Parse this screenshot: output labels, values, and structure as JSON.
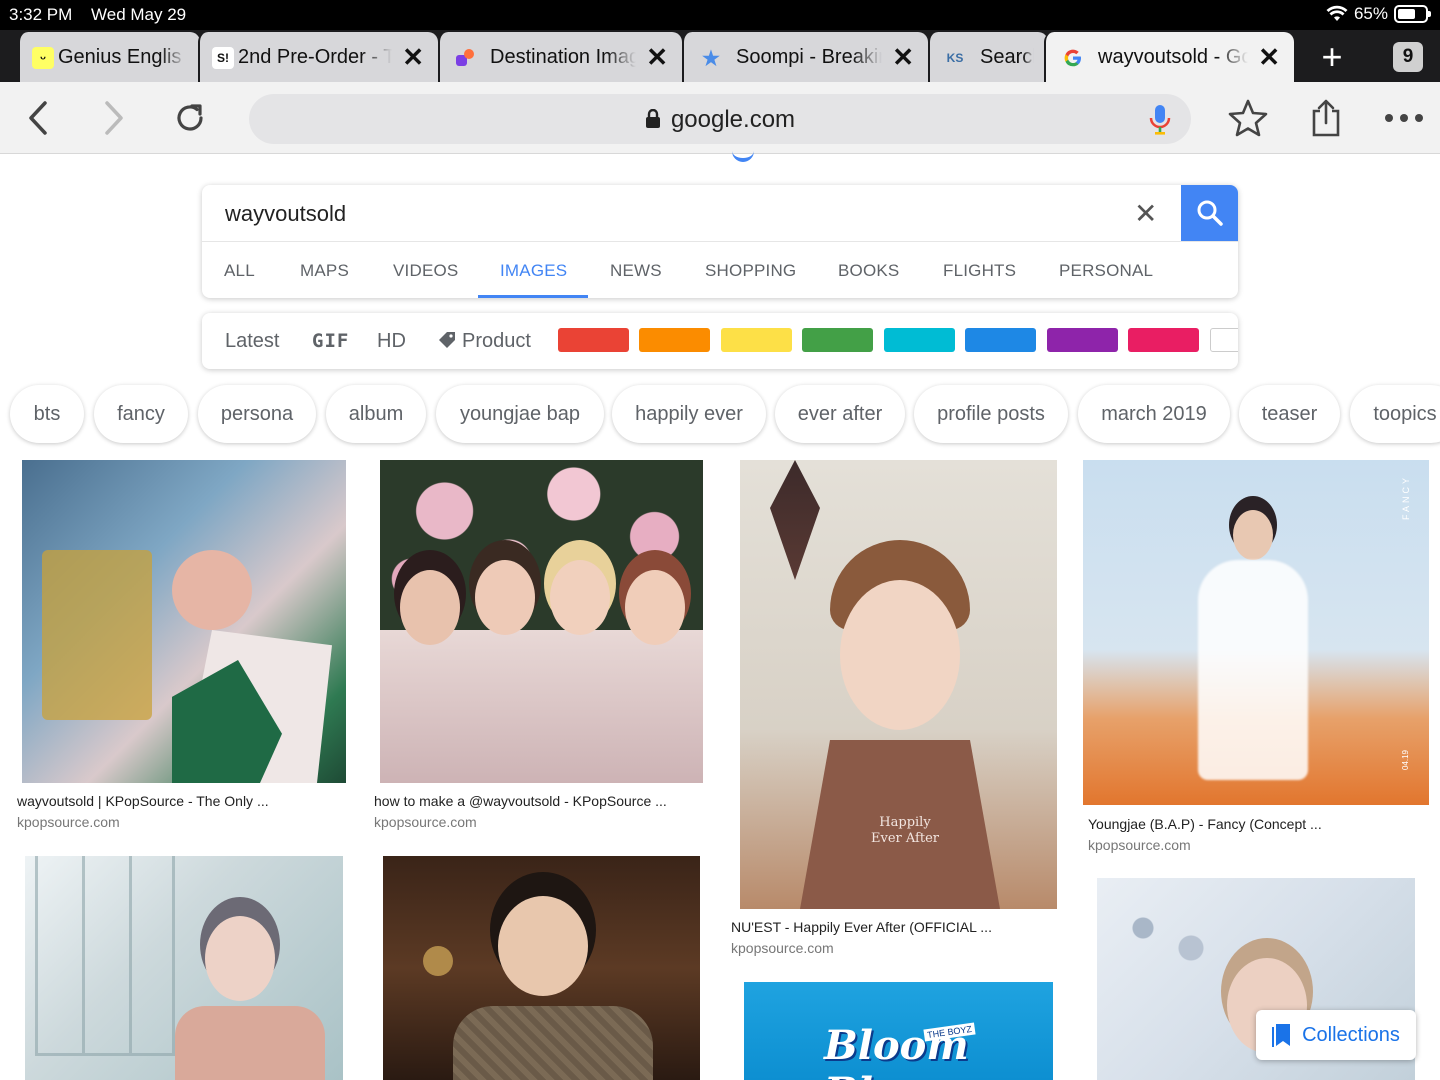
{
  "status_bar": {
    "time": "3:32 PM",
    "date": "Wed May 29",
    "battery": "65%",
    "battery_level": 0.65
  },
  "tabs": [
    {
      "title": "Genius Englis",
      "favicon": "genius-smiley-icon"
    },
    {
      "title": "2nd Pre-Order - T",
      "favicon": "sn-logo-icon"
    },
    {
      "title": "Destination Imag",
      "favicon": "colorful-shapes-icon"
    },
    {
      "title": "Soompi - Breakin",
      "favicon": "star-icon"
    },
    {
      "title": "Searcl",
      "favicon": "ks-logo-icon"
    },
    {
      "title": "wayvoutsold - Go",
      "favicon": "google-g-icon",
      "active": true
    }
  ],
  "tab_count": "9",
  "address": {
    "url": "google.com"
  },
  "search": {
    "query": "wayvoutsold",
    "nav": [
      "ALL",
      "MAPS",
      "VIDEOS",
      "IMAGES",
      "NEWS",
      "SHOPPING",
      "BOOKS",
      "FLIGHTS",
      "PERSONAL"
    ],
    "active_nav": "IMAGES"
  },
  "tools": {
    "latest": "Latest",
    "gif": "GIF",
    "hd": "HD",
    "product": "Product",
    "colors": [
      "#ea4335",
      "#fb8c00",
      "#fde047",
      "#43a047",
      "#00bcd4",
      "#1e88e5",
      "#8e24aa",
      "#e91e63",
      "#ffffff"
    ]
  },
  "chips": [
    "bts",
    "fancy",
    "persona",
    "album",
    "youngjae bap",
    "happily ever",
    "ever after",
    "profile posts",
    "march 2019",
    "teaser",
    "toopics"
  ],
  "results": [
    {
      "caption": "wayvoutsold | KPopSource - The Only ...",
      "source": "kpopsource.com"
    },
    {
      "caption": "how to make a @wayvoutsold - KPopSource ...",
      "source": "kpopsource.com"
    },
    {
      "caption": "NU'EST - Happily Ever After (OFFICIAL ...",
      "source": "kpopsource.com",
      "overlay_text": "Happily Ever After"
    },
    {
      "caption": "Youngjae (B.A.P) - Fancy (Concept ...",
      "source": "kpopsource.com",
      "overlay_text": "FANCY",
      "overlay_date": "04.19"
    },
    {
      "overlay_text": "Bloom Bloom",
      "overlay_sub": "THE BOYZ"
    }
  ],
  "collections_label": "Collections"
}
